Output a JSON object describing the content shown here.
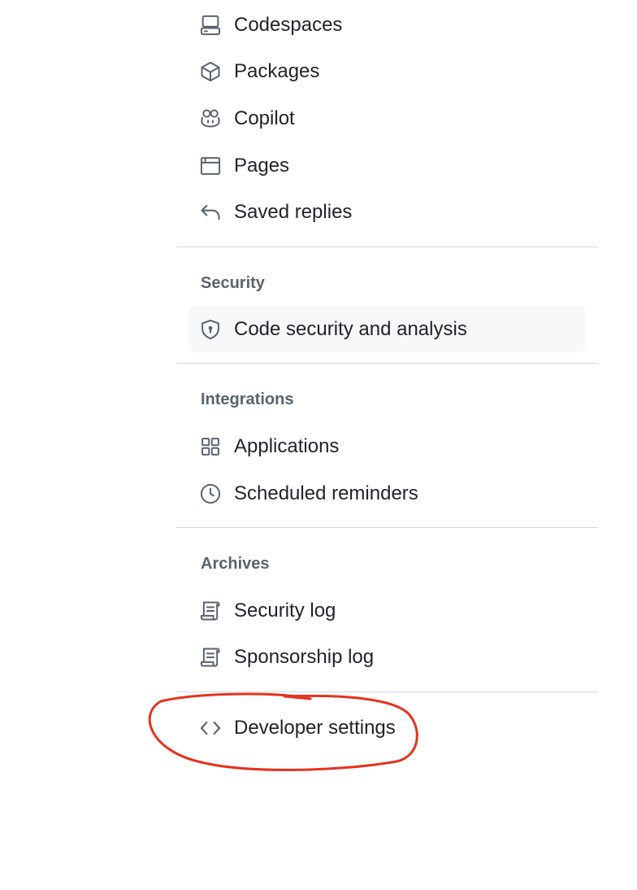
{
  "nav": {
    "items": [
      {
        "label": "Codespaces",
        "icon": "codespaces-icon"
      },
      {
        "label": "Packages",
        "icon": "package-icon"
      },
      {
        "label": "Copilot",
        "icon": "copilot-icon"
      },
      {
        "label": "Pages",
        "icon": "browser-icon"
      },
      {
        "label": "Saved replies",
        "icon": "reply-icon"
      }
    ],
    "security": {
      "heading": "Security",
      "items": [
        {
          "label": "Code security and analysis",
          "icon": "shield-lock-icon",
          "active": true
        }
      ]
    },
    "integrations": {
      "heading": "Integrations",
      "items": [
        {
          "label": "Applications",
          "icon": "apps-icon"
        },
        {
          "label": "Scheduled reminders",
          "icon": "clock-icon"
        }
      ]
    },
    "archives": {
      "heading": "Archives",
      "items": [
        {
          "label": "Security log",
          "icon": "log-icon"
        },
        {
          "label": "Sponsorship log",
          "icon": "log-icon"
        }
      ]
    },
    "developer_settings": {
      "label": "Developer settings",
      "icon": "code-icon"
    }
  },
  "colors": {
    "text": "#1f2328",
    "muted": "#59636e",
    "icon": "#59636e",
    "divider": "#d1d9e0",
    "active_bg": "#f6f8fa",
    "annotation": "#e5321e"
  }
}
